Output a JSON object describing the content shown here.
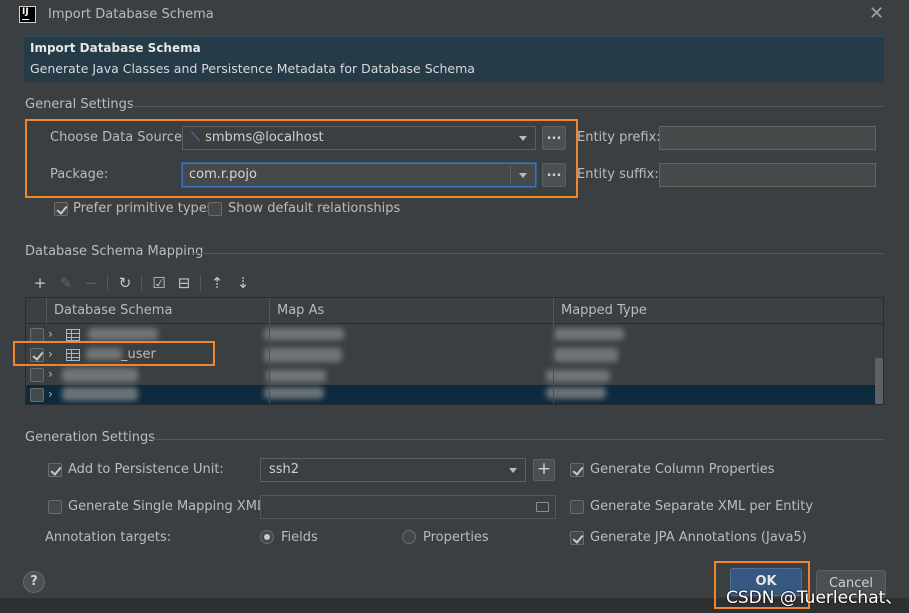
{
  "window": {
    "title": "Import Database Schema",
    "close_icon": "close-icon"
  },
  "banner": {
    "title": "Import Database Schema",
    "subtitle": "Generate Java Classes and Persistence Metadata for Database Schema"
  },
  "general_settings": {
    "title": "General Settings",
    "data_source_label": "Choose Data Source:",
    "data_source_value": "smbms@localhost",
    "package_label": "Package:",
    "package_value": "com.r.pojo",
    "browse_label": "...",
    "entity_prefix_label": "Entity prefix:",
    "entity_prefix_value": "",
    "entity_suffix_label": "Entity suffix:",
    "entity_suffix_value": "",
    "prefer_primitive_label": "Prefer primitive types",
    "prefer_primitive_checked": true,
    "show_default_rel_label": "Show default relationships",
    "show_default_rel_checked": false
  },
  "mapping": {
    "title": "Database Schema Mapping",
    "toolbar": [
      "add-icon",
      "edit-icon",
      "remove-icon",
      "refresh-icon",
      "check-all-icon",
      "uncheck-icon",
      "expand-all-icon",
      "collapse-all-icon"
    ],
    "columns": [
      "Database Schema",
      "Map As",
      "Mapped Type"
    ],
    "rows": [
      {
        "checked": false,
        "name": "",
        "map_as": "",
        "mapped_type": ""
      },
      {
        "checked": true,
        "name": "_user",
        "map_as": "",
        "mapped_type": ""
      },
      {
        "checked": false,
        "name": "",
        "map_as": "",
        "mapped_type": ""
      },
      {
        "checked": false,
        "name": "",
        "map_as": "",
        "mapped_type": ""
      }
    ]
  },
  "generation": {
    "title": "Generation Settings",
    "add_persistence_label": "Add to Persistence Unit:",
    "add_persistence_checked": true,
    "persistence_unit_value": "ssh2",
    "add_btn": "+",
    "single_mapping_label": "Generate Single Mapping XML:",
    "single_mapping_checked": false,
    "single_mapping_value": "",
    "annotation_targets_label": "Annotation targets:",
    "fields_label": "Fields",
    "fields_selected": true,
    "properties_label": "Properties",
    "properties_selected": false,
    "gen_column_props_label": "Generate Column Properties",
    "gen_column_props_checked": true,
    "gen_separate_xml_label": "Generate Separate XML per Entity",
    "gen_separate_xml_checked": false,
    "gen_jpa_label": "Generate JPA Annotations (Java5)",
    "gen_jpa_checked": true
  },
  "footer": {
    "help_label": "?",
    "ok_label": "OK",
    "cancel_label": "Cancel",
    "watermark": "CSDN @Tuerlechat、"
  },
  "colors": {
    "highlight": "#f0852d",
    "selection_row": "#0d293e",
    "primary_button": "#365880"
  }
}
